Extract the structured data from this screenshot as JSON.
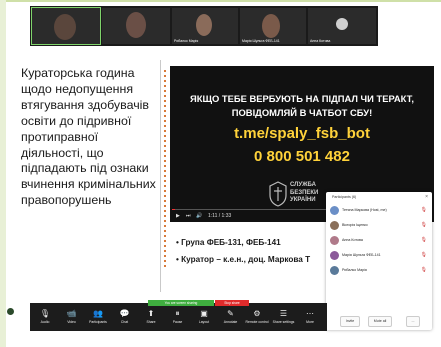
{
  "thumbnails": [
    {
      "name": "",
      "active": true,
      "bg": "#3a3a3a"
    },
    {
      "name": "",
      "active": false,
      "bg": "#3f2e2e"
    },
    {
      "name": "Рибалко Марія",
      "active": false,
      "bg": "#2e2e34"
    },
    {
      "name": "Марія Шульга ФЕБ-141",
      "active": false,
      "bg": "#3a3333"
    },
    {
      "name": "Анна Котова",
      "active": false,
      "bg": "#2b2b2b"
    }
  ],
  "slide": {
    "left_text": "Кураторська година щодо недопущення втягування здобувачів освіти до підривної протиправної діяльності, що підпадають під ознаки вчинення кримінальних правопорушень",
    "video": {
      "line1": "ЯКЩО ТЕБЕ ВЕРБУЮТЬ НА ПІДПАЛ ЧИ ТЕРАКТ,",
      "line2": "ПОВІДОМЛЯЙ В ЧАТБОТ СБУ!",
      "link": "t.me/spaly_fsb_bot",
      "phone": "0 800 501 482",
      "org_line1": "СЛУЖБА",
      "org_line2": "БЕЗПЕКИ",
      "org_line3": "УКРАЇНИ",
      "time": "1:11 / 1:33"
    },
    "bullets": [
      "Група ФЕБ-131, ФЕБ-141",
      "Куратор – к.е.н., доц. Маркова Т"
    ]
  },
  "participants_panel": {
    "title": "Participants (6)",
    "participants": [
      {
        "name": "Тетяна Маркова (Host, me)",
        "color": "#6b8fc7"
      },
      {
        "name": "Вікторія Іщенко",
        "color": "#8a6f5a"
      },
      {
        "name": "Анна Котова",
        "color": "#b07a8a"
      },
      {
        "name": "Марія Шульга ФЕБ-141",
        "color": "#8b5a9a"
      },
      {
        "name": "Рибалко Марія",
        "color": "#5a7a9a"
      }
    ],
    "invite_label": "Invite",
    "mute_all_label": "Mute all",
    "more_label": "..."
  },
  "toolbar": {
    "share_banner": "You are screen sharing",
    "stop_label": "Stop share",
    "items": [
      {
        "icon": "🎙",
        "label": "Audio"
      },
      {
        "icon": "📹",
        "label": "Video"
      },
      {
        "icon": "👥",
        "label": "Participants"
      },
      {
        "icon": "💬",
        "label": "Chat"
      },
      {
        "icon": "⬆",
        "label": "Share"
      },
      {
        "icon": "⏸",
        "label": "Pause"
      },
      {
        "icon": "▣",
        "label": "Layout"
      },
      {
        "icon": "✎",
        "label": "Annotate"
      },
      {
        "icon": "⚙",
        "label": "Remote control"
      },
      {
        "icon": "☰",
        "label": "Share settings"
      },
      {
        "icon": "⋯",
        "label": "More"
      }
    ]
  }
}
